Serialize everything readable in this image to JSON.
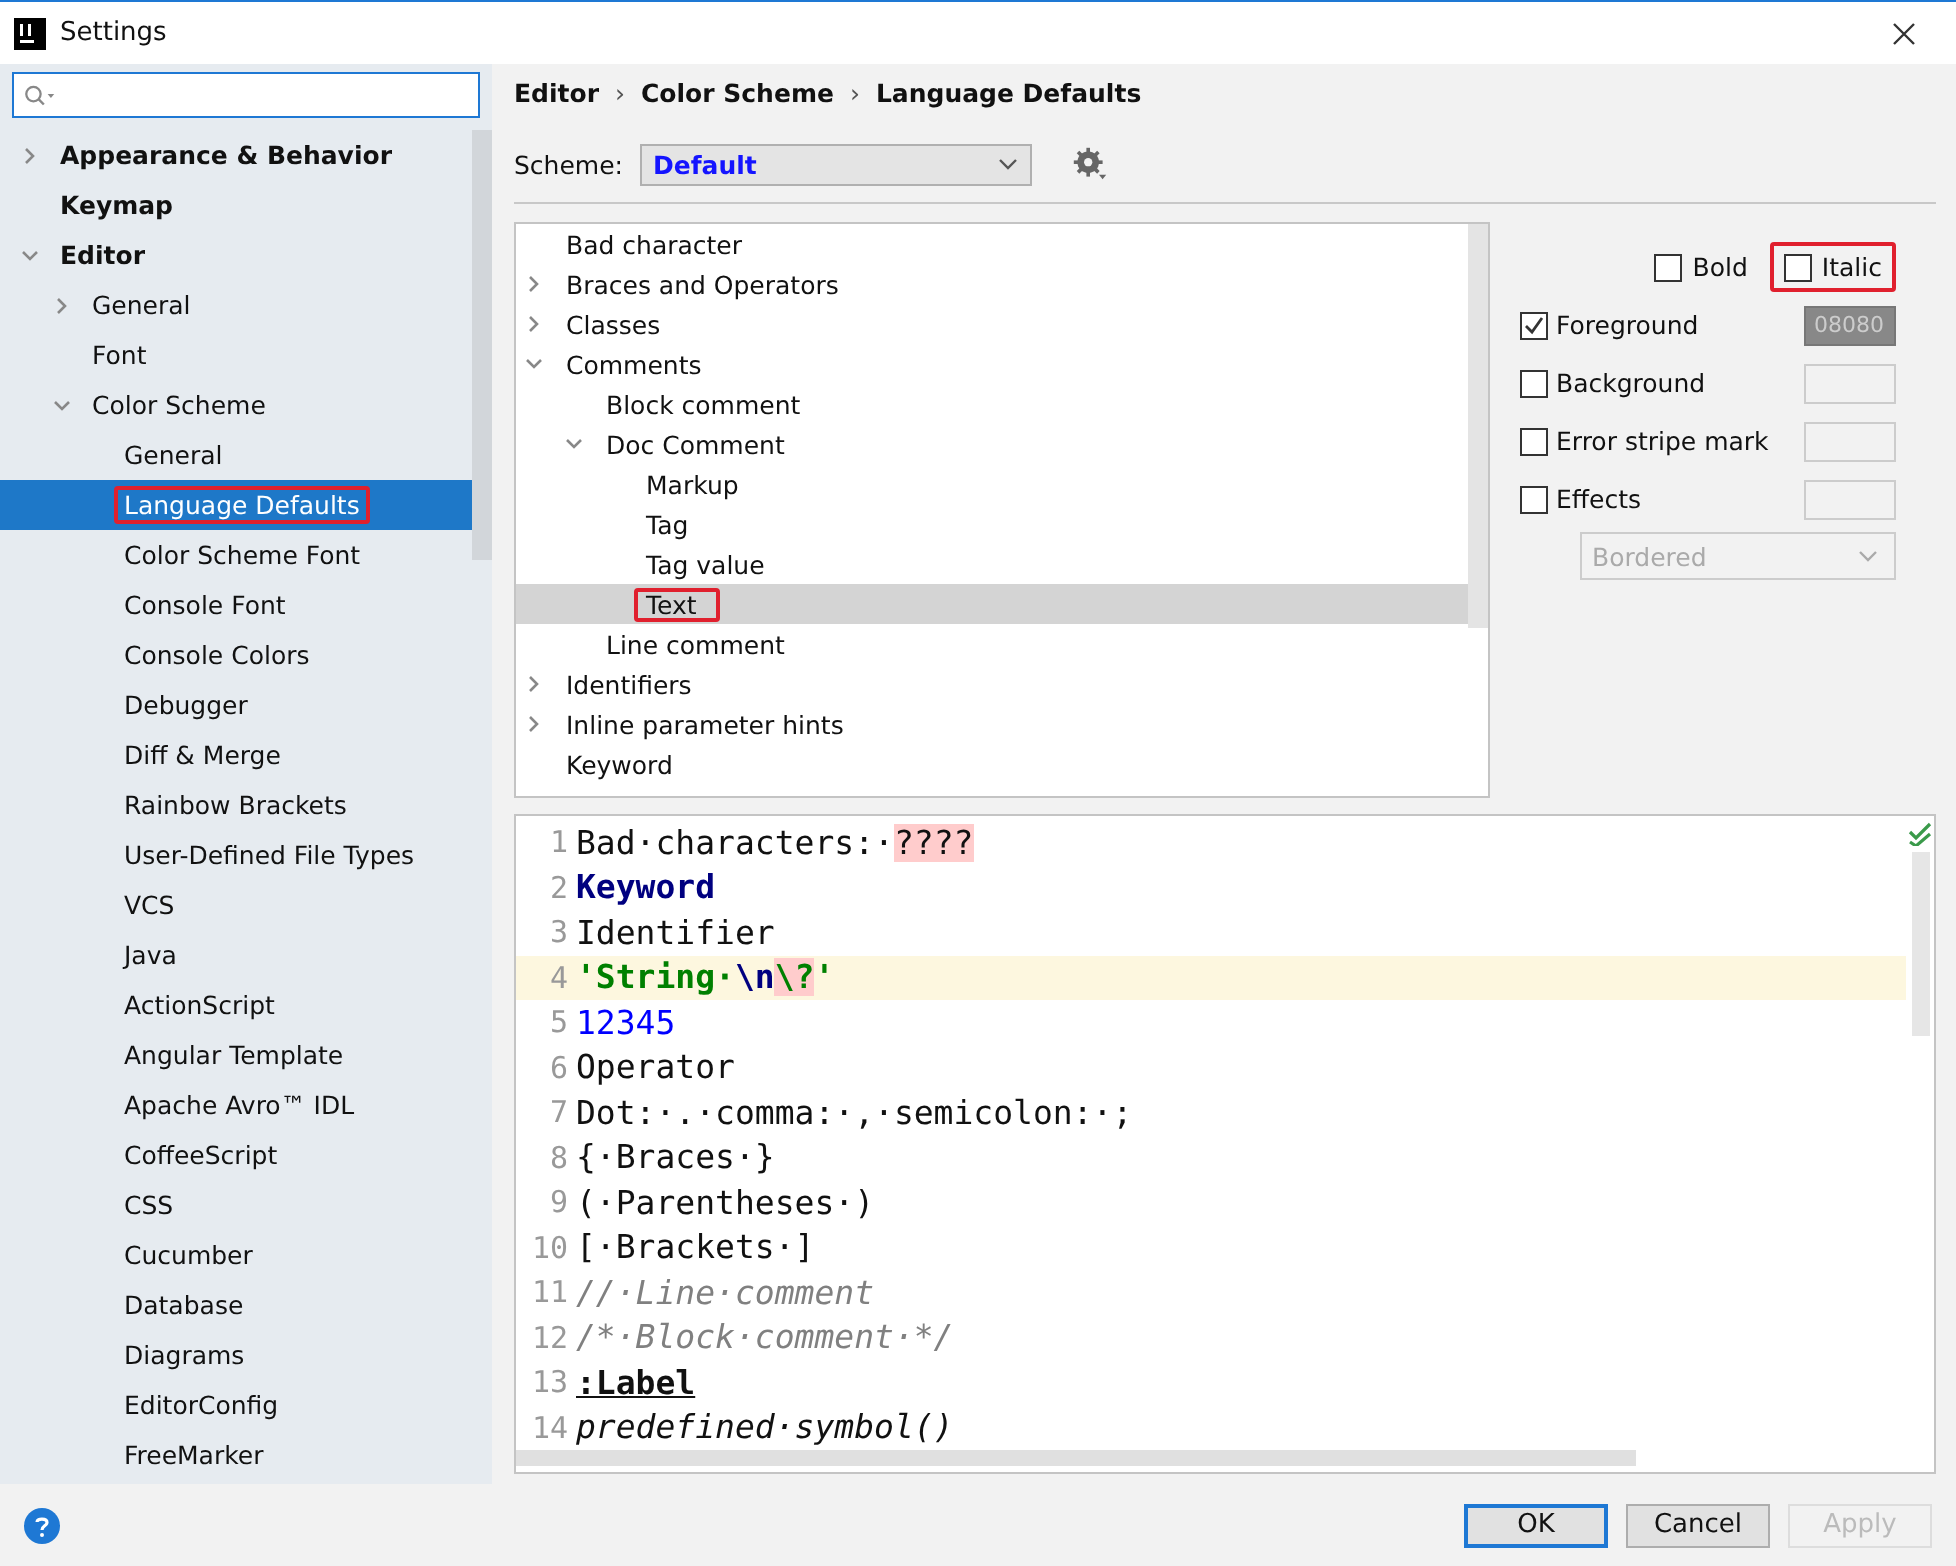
{
  "window": {
    "title": "Settings"
  },
  "sidebar": {
    "items": [
      {
        "label": "Appearance & Behavior",
        "expanded": false,
        "selected": false
      },
      {
        "label": "Keymap",
        "selected": false
      },
      {
        "label": "Editor",
        "expanded": true,
        "selected": false,
        "children": [
          {
            "label": "General",
            "expanded": false,
            "selected": false
          },
          {
            "label": "Font",
            "selected": false
          },
          {
            "label": "Color Scheme",
            "expanded": true,
            "selected": false,
            "children": [
              {
                "label": "General",
                "selected": false
              },
              {
                "label": "Language Defaults",
                "selected": true,
                "highlighted": true
              },
              {
                "label": "Color Scheme Font",
                "selected": false
              },
              {
                "label": "Console Font",
                "selected": false
              },
              {
                "label": "Console Colors",
                "selected": false
              },
              {
                "label": "Debugger",
                "selected": false
              },
              {
                "label": "Diff & Merge",
                "selected": false
              },
              {
                "label": "Rainbow Brackets",
                "selected": false
              },
              {
                "label": "User-Defined File Types",
                "selected": false
              },
              {
                "label": "VCS",
                "selected": false
              },
              {
                "label": "Java",
                "selected": false
              },
              {
                "label": "ActionScript",
                "selected": false
              },
              {
                "label": "Angular Template",
                "selected": false
              },
              {
                "label": "Apache Avro™ IDL",
                "selected": false
              },
              {
                "label": "CoffeeScript",
                "selected": false
              },
              {
                "label": "CSS",
                "selected": false
              },
              {
                "label": "Cucumber",
                "selected": false
              },
              {
                "label": "Database",
                "selected": false
              },
              {
                "label": "Diagrams",
                "selected": false
              },
              {
                "label": "EditorConfig",
                "selected": false
              },
              {
                "label": "FreeMarker",
                "selected": false
              }
            ]
          }
        ]
      }
    ]
  },
  "breadcrumb": [
    "Editor",
    "Color Scheme",
    "Language Defaults"
  ],
  "breadcrumb_separator": "›",
  "scheme": {
    "label": "Scheme:",
    "value": "Default"
  },
  "tree": {
    "items": [
      {
        "label": "Bad character",
        "selected": false
      },
      {
        "label": "Braces and Operators",
        "expanded": false,
        "selected": false
      },
      {
        "label": "Classes",
        "expanded": false,
        "selected": false
      },
      {
        "label": "Comments",
        "expanded": true,
        "selected": false,
        "children": [
          {
            "label": "Block comment",
            "selected": false
          },
          {
            "label": "Doc Comment",
            "expanded": true,
            "selected": false,
            "children": [
              {
                "label": "Markup",
                "selected": false
              },
              {
                "label": "Tag",
                "selected": false
              },
              {
                "label": "Tag value",
                "selected": false
              },
              {
                "label": "Text",
                "selected": true,
                "highlighted": true
              }
            ]
          },
          {
            "label": "Line comment",
            "selected": false
          }
        ]
      },
      {
        "label": "Identifiers",
        "expanded": false,
        "selected": false
      },
      {
        "label": "Inline parameter hints",
        "expanded": false,
        "selected": false
      },
      {
        "label": "Keyword",
        "selected": false
      }
    ]
  },
  "font_style": [
    {
      "label": "Bold",
      "checked": false
    },
    {
      "label": "Italic",
      "checked": false,
      "highlighted": true
    }
  ],
  "attributes": [
    {
      "label": "Foreground",
      "checked": true,
      "value": "08080"
    },
    {
      "label": "Background",
      "checked": false
    },
    {
      "label": "Error stripe mark",
      "checked": false
    },
    {
      "label": "Effects",
      "checked": false
    }
  ],
  "effect_type": {
    "value": "Bordered",
    "disabled": true
  },
  "preview": {
    "lines": [
      {
        "number": "1",
        "current": false,
        "segments": [
          {
            "kind": "plain",
            "text": "Bad·characters:·"
          },
          {
            "kind": "bad",
            "text": "????"
          }
        ]
      },
      {
        "number": "2",
        "current": false,
        "segments": [
          {
            "kind": "keyword",
            "text": "Keyword"
          }
        ]
      },
      {
        "number": "3",
        "current": false,
        "segments": [
          {
            "kind": "plain",
            "text": "Identifier"
          }
        ]
      },
      {
        "number": "4",
        "current": true,
        "segments": [
          {
            "kind": "string",
            "text": "'String·"
          },
          {
            "kind": "escape",
            "text": "\\n"
          },
          {
            "kind": "bad-escape",
            "text": "\\?"
          },
          {
            "kind": "string",
            "text": "'"
          }
        ]
      },
      {
        "number": "5",
        "current": false,
        "segments": [
          {
            "kind": "number",
            "text": "12345"
          }
        ]
      },
      {
        "number": "6",
        "current": false,
        "segments": [
          {
            "kind": "plain",
            "text": "Operator"
          }
        ]
      },
      {
        "number": "7",
        "current": false,
        "segments": [
          {
            "kind": "plain",
            "text": "Dot:·.·comma:·,·semicolon:·;"
          }
        ]
      },
      {
        "number": "8",
        "current": false,
        "segments": [
          {
            "kind": "plain",
            "text": "{·Braces·}"
          }
        ]
      },
      {
        "number": "9",
        "current": false,
        "segments": [
          {
            "kind": "plain",
            "text": "(·Parentheses·)"
          }
        ]
      },
      {
        "number": "10",
        "current": false,
        "segments": [
          {
            "kind": "plain",
            "text": "[·Brackets·]"
          }
        ]
      },
      {
        "number": "11",
        "current": false,
        "segments": [
          {
            "kind": "comment",
            "text": "//·Line·comment"
          }
        ]
      },
      {
        "number": "12",
        "current": false,
        "segments": [
          {
            "kind": "comment",
            "text": "/*·Block·comment·*/"
          }
        ]
      },
      {
        "number": "13",
        "current": false,
        "segments": [
          {
            "kind": "label",
            "text": ":Label"
          }
        ]
      },
      {
        "number": "14",
        "current": false,
        "segments": [
          {
            "kind": "predefined",
            "text": "predefined·symbol()"
          }
        ]
      }
    ]
  },
  "buttons": [
    {
      "label": "OK",
      "default": true,
      "disabled": false
    },
    {
      "label": "Cancel",
      "default": false,
      "disabled": false
    },
    {
      "label": "Apply",
      "default": false,
      "disabled": true
    }
  ]
}
